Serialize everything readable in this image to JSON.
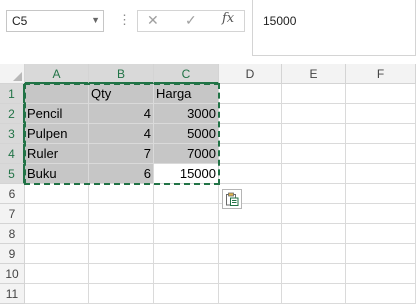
{
  "name_box": {
    "value": "C5"
  },
  "formula_bar": {
    "value": "15000",
    "fx_label": "fx"
  },
  "icons": {
    "cancel": "✕",
    "enter": "✓",
    "name_box_dropdown": "▼",
    "separator_dots": "⋮"
  },
  "columns": [
    "A",
    "B",
    "C",
    "D",
    "E",
    "F"
  ],
  "rows": [
    "1",
    "2",
    "3",
    "4",
    "5",
    "6",
    "7",
    "8",
    "9",
    "10",
    "11"
  ],
  "cells": {
    "A1": "",
    "B1": "Qty",
    "C1": "Harga",
    "A2": "Pencil",
    "B2": "4",
    "C2": "3000",
    "A3": "Pulpen",
    "B3": "4",
    "C3": "5000",
    "A4": "Ruler",
    "B4": "7",
    "C4": "7000",
    "A5": "Buku",
    "B5": "6",
    "C5": "15000"
  },
  "selection": {
    "range": "A1:C5",
    "active_cell": "C5",
    "copy_marquee": true
  },
  "colors": {
    "accent": "#217346",
    "selected_fill": "#c6c6c6",
    "header_fill": "#f3f3f3"
  }
}
